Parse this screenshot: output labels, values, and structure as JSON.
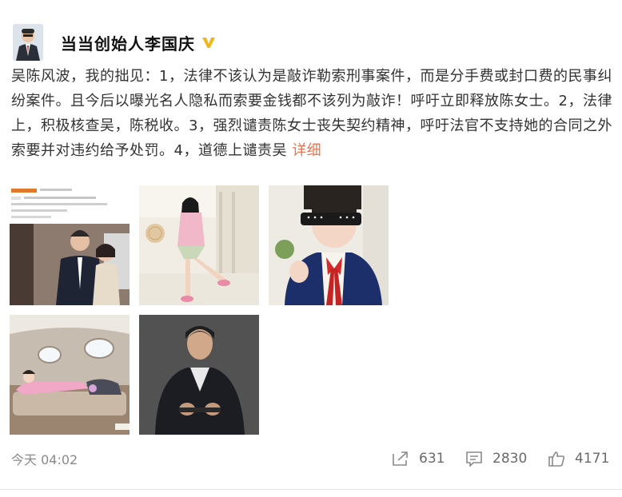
{
  "post": {
    "author": "当当创始人李国庆",
    "verified_icon": "verified-badge-icon",
    "text": "吴陈风波，我的拙见：1，法律不该认为是敲诈勒索刑事案件，而是分手费或封口费的民事纠纷案件。且今后以曝光名人隐私而索要金钱都不该列为敲诈！呼吁立即释放陈女士。2，法律上，积极核查吴，陈税收。3，强烈谴责陈女士丧失契约精神，呼吁法官不支持她的合同之外索要并对违约给予处罚。4，道德上谴责吴",
    "more_label": "详细",
    "more_color": "#eb7350",
    "timestamp": "今天 04:02"
  },
  "images": [
    {
      "name": "image-screenshot-couple"
    },
    {
      "name": "image-woman-garden"
    },
    {
      "name": "image-woman-sunglasses"
    },
    {
      "name": "image-jet-interior"
    },
    {
      "name": "image-man-portrait"
    }
  ],
  "actions": {
    "forward": {
      "icon": "forward-icon",
      "count": "631"
    },
    "comment": {
      "icon": "comment-icon",
      "count": "2830"
    },
    "like": {
      "icon": "thumbs-up-icon",
      "count": "4171"
    }
  }
}
